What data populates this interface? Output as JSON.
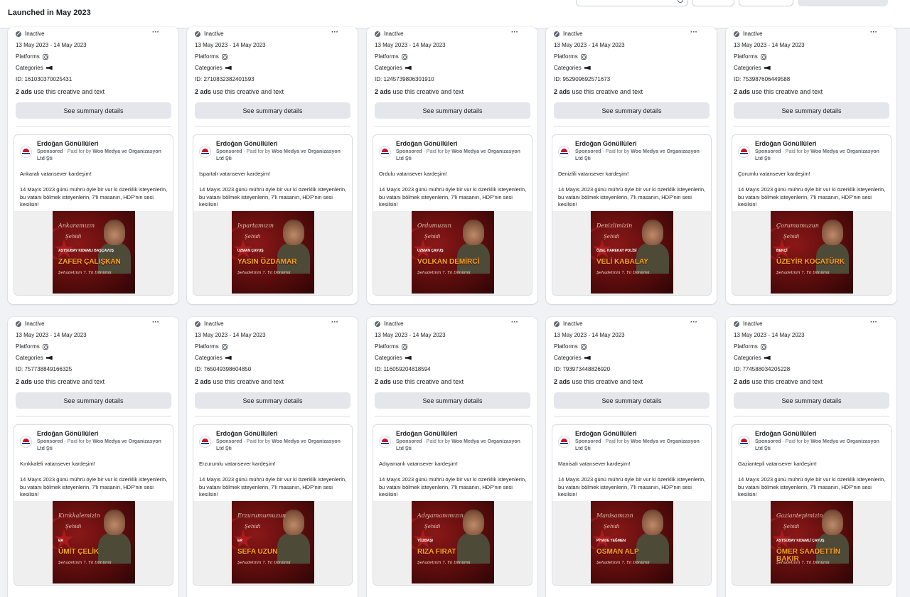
{
  "header": {
    "title": "Launched in May 2023"
  },
  "labels": {
    "platforms": "Platforms",
    "categories": "Categories",
    "ads_count": "2 ads",
    "ads_suffix": "use this creative and text",
    "summary_button": "See summary details",
    "sponsored": "Sponsored",
    "paid_for_prefix": " · Paid for by ",
    "paid_for_by": "Woo Medya ve Organizasyon Ltd Şti",
    "page_name": "Erdoğan Gönüllüleri",
    "ad_body": "14 Mayıs 2023 günü mührü öyle bir vur ki özerklik isteyenlerin, bu vatanı bölmek isteyenlerin, 7'li masanın, HDP'nin sesi kesilsin!",
    "memorial": "Şehadetinin 7. Yıl Dönümü"
  },
  "icons": {
    "status": "inactive-icon",
    "platform": "instagram-icon",
    "category": "megaphone-icon",
    "more": "more-options-icon",
    "search": "search-icon"
  },
  "colors": {
    "status_gray": "#606770",
    "button_bg": "#e4e6eb",
    "poster_red": "#8a1818",
    "name_gold": "#f5a623"
  },
  "cards": [
    {
      "status": "Inactive",
      "dates": "13 May 2023 - 14 May 2023",
      "id": "ID: 1610303700254​31",
      "greeting": "Ankaralı vatansever kardeşim!",
      "script_title": "Ankaramızın",
      "rank": "ASTSUBAY KIDEMLI BAŞÇAVUŞ",
      "soldier": "ZAFER ÇALIŞKAN"
    },
    {
      "status": "Inactive",
      "dates": "13 May 2023 - 14 May 2023",
      "id": "ID: 2710832382401593",
      "greeting": "Ispartalı vatansever kardeşim!",
      "script_title": "Ispartamızın",
      "rank": "UZMAN ÇAVUŞ",
      "soldier": "YASIN ÖZDAMAR"
    },
    {
      "status": "Inactive",
      "dates": "13 May 2023 - 14 May 2023",
      "id": "ID: 1245739806301910",
      "greeting": "Ordulu vatansever kardeşim!",
      "script_title": "Ordumuzun",
      "rank": "UZMAN ÇAVUŞ",
      "soldier": "VOLKAN DEMİRCİ"
    },
    {
      "status": "Inactive",
      "dates": "13 May 2023 - 14 May 2023",
      "id": "ID: 952909692571673",
      "greeting": "Denizlili vatansever kardeşim!",
      "script_title": "Denizlimizin",
      "rank": "ÖZEL HAREKAT POLİSİ",
      "soldier": "VELİ KABALAY"
    },
    {
      "status": "Inactive",
      "dates": "13 May 2023 - 14 May 2023",
      "id": "ID: 753987606449588",
      "greeting": "Çorumlu vatansever kardeşim!",
      "script_title": "Çorumumuzun",
      "rank": "BEKÇİ",
      "soldier": "ÜZEYİR KOCATÜRK"
    },
    {
      "status": "Inactive",
      "dates": "13 May 2023 - 14 May 2023",
      "id": "ID: 757738849166325",
      "greeting": "Kırıkkaleli vatansever kardeşim!",
      "script_title": "Kırıkkalemizin",
      "rank": "ER",
      "soldier": "ÜMİT ÇELİK"
    },
    {
      "status": "Inactive",
      "dates": "13 May 2023 - 14 May 2023",
      "id": "ID: 765049398604850",
      "greeting": "Erzurumlu vatansever kardeşim!",
      "script_title": "Erzurumumuzun",
      "rank": "ER",
      "soldier": "SEFA UZUN"
    },
    {
      "status": "Inactive",
      "dates": "13 May 2023 - 14 May 2023",
      "id": "ID: 116059204818594",
      "greeting": "Adıyamanlı vatansever kardeşim!",
      "script_title": "Adıyamanımızın",
      "rank": "YÜZBAŞI",
      "soldier": "RIZA FIRAT"
    },
    {
      "status": "Inactive",
      "dates": "13 May 2023 - 14 May 2023",
      "id": "ID: 793973448826920",
      "greeting": "Manisalı vatansever kardeşim!",
      "script_title": "Manisamızın",
      "rank": "PİYADE TEĞMEN",
      "soldier": "OSMAN ALP"
    },
    {
      "status": "Inactive",
      "dates": "13 May 2023 - 14 May 2023",
      "id": "ID: 774588034205228",
      "greeting": "Gaziantepli vatansever kardeşim!",
      "script_title": "Gaziantepimizin",
      "rank": "ASTSUBAY KIDEMLİ ÇAVUŞ",
      "soldier": "ÖMER SAADETTİN BAKIR"
    }
  ]
}
